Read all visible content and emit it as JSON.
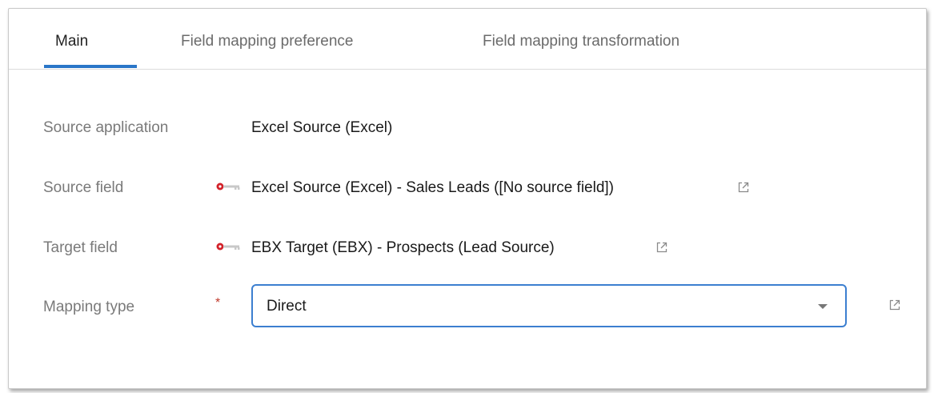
{
  "tabs": [
    {
      "label": "Main",
      "active": true
    },
    {
      "label": "Field mapping preference",
      "active": false
    },
    {
      "label": "Field mapping transformation",
      "active": false
    }
  ],
  "form": {
    "source_application": {
      "label": "Source application",
      "value": "Excel Source (Excel)"
    },
    "source_field": {
      "label": "Source field",
      "value": "Excel Source (Excel) - Sales Leads ([No source field])",
      "icon": "key-icon"
    },
    "target_field": {
      "label": "Target field",
      "value": "EBX Target (EBX) - Prospects (Lead Source)",
      "icon": "key-icon"
    },
    "mapping_type": {
      "label": "Mapping type",
      "required_mark": "*",
      "value": "Direct"
    }
  },
  "colors": {
    "accent": "#2a76c8",
    "key_icon_red": "#d3222a",
    "label_gray": "#7a7a7a"
  }
}
